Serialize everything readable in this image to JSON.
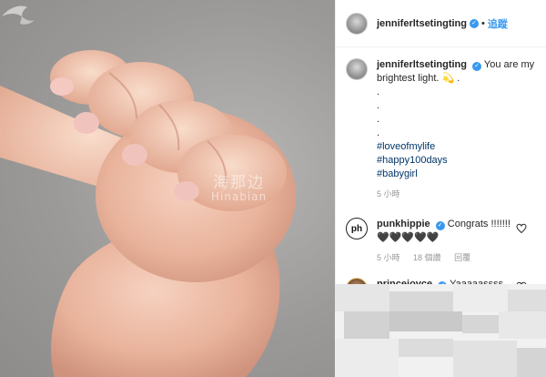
{
  "watermark": {
    "cn": "海那边",
    "en": "Hinabian"
  },
  "header": {
    "username": "jenniferltsetingting",
    "follow_label": "追蹤"
  },
  "post": {
    "username": "jenniferltsetingting",
    "caption": "You are my brightest light. 💫 .",
    "dots": [
      ".",
      ".",
      ".",
      "."
    ],
    "hashtags": [
      "#loveofmylife",
      "#happy100days",
      "#babygirl"
    ],
    "time": "5 小時"
  },
  "comments": [
    {
      "username": "punkhippie",
      "avatar_text": "ph",
      "text": "Congrats !!!!!!! 🖤🖤🖤🖤🖤",
      "time": "5 小時",
      "likes": "18 個讚",
      "reply": "回覆"
    },
    {
      "username": "princejoyce",
      "text": "Yaaaaassss jb!!! 😭😭😭😭"
    }
  ],
  "colors": {
    "link": "#003569",
    "accent": "#3897f0",
    "muted": "#999999"
  }
}
